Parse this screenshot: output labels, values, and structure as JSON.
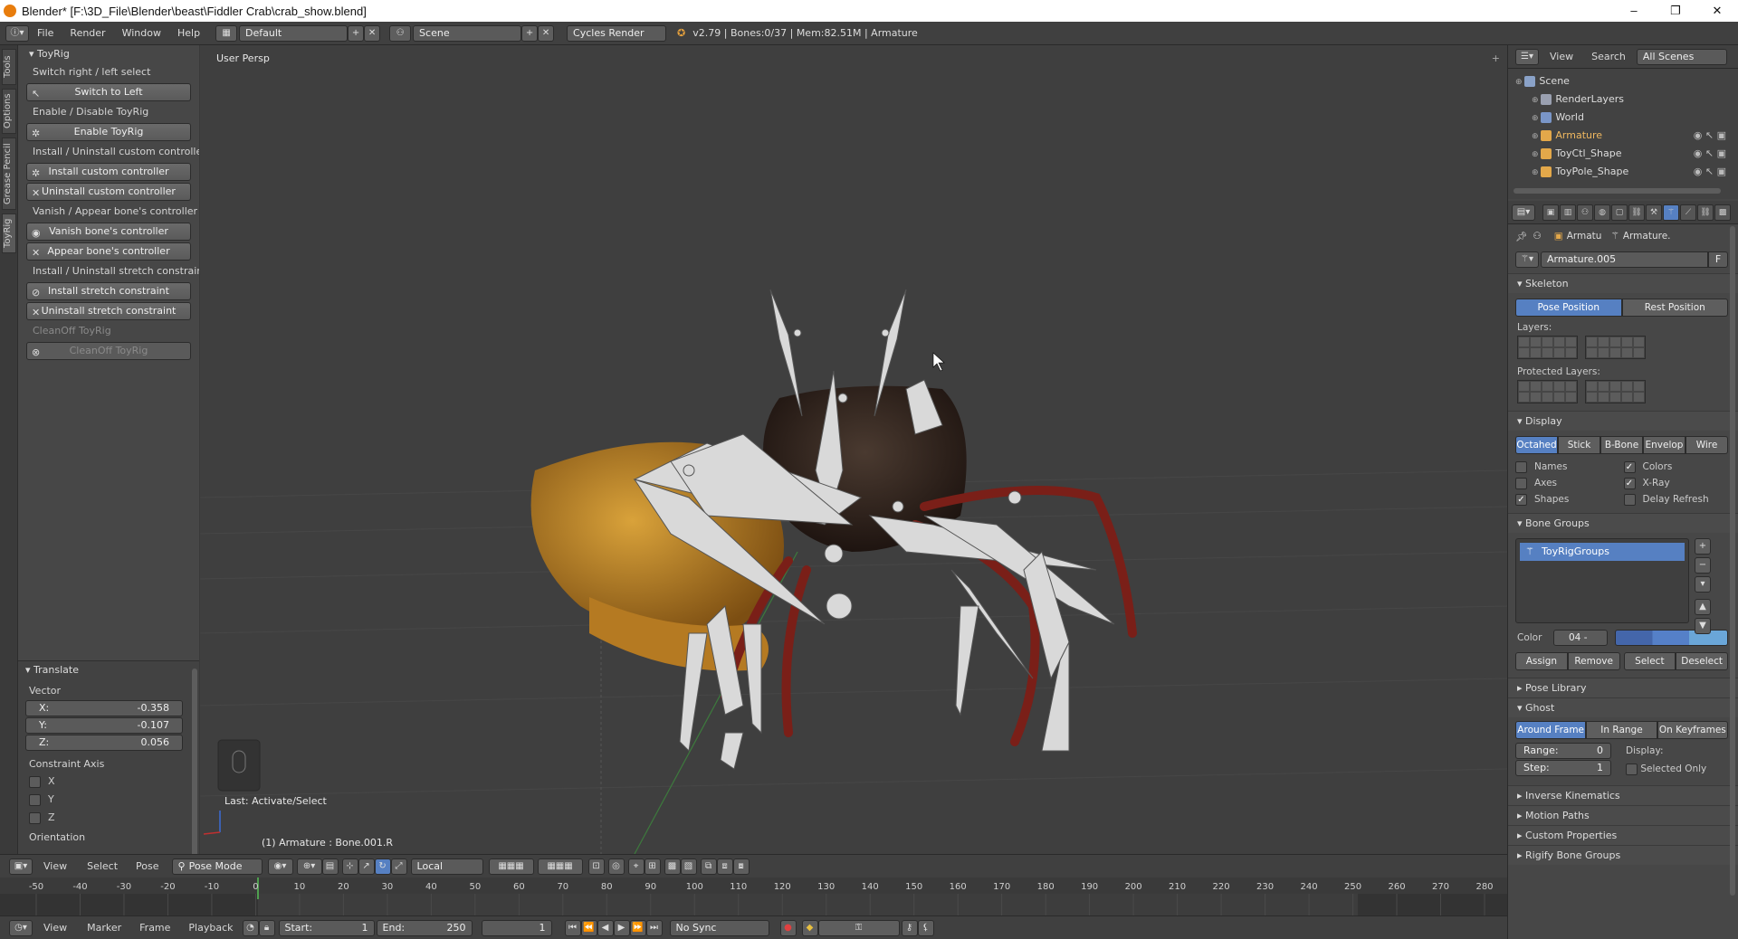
{
  "window": {
    "title": "Blender* [F:\\3D_File\\Blender\\beast\\Fiddler Crab\\crab_show.blend]",
    "controls": [
      "–",
      "❐",
      "✕"
    ]
  },
  "topbar": {
    "menus": [
      "File",
      "Render",
      "Window",
      "Help"
    ],
    "layout": "Default",
    "scene": "Scene",
    "engine": "Cycles Render",
    "stats": "v2.79 | Bones:0/37 | Mem:82.51M | Armature"
  },
  "left_tabs": [
    "Tools",
    "Options",
    "Grease Pencil",
    "ToyRig"
  ],
  "toyrig": {
    "header": "ToyRig",
    "rows": [
      {
        "kind": "label",
        "text": "Switch right / left select"
      },
      {
        "kind": "button",
        "text": "Switch to Left",
        "icon": "↖"
      },
      {
        "kind": "label",
        "text": "Enable / Disable ToyRig"
      },
      {
        "kind": "button",
        "text": "Enable ToyRig",
        "icon": "✲"
      },
      {
        "kind": "label",
        "text": "Install / Uninstall custom controller"
      },
      {
        "kind": "button",
        "text": "Install custom controller",
        "icon": "✲"
      },
      {
        "kind": "button",
        "text": "Uninstall custom controller",
        "icon": "✕"
      },
      {
        "kind": "label",
        "text": "Vanish / Appear bone's controller"
      },
      {
        "kind": "button",
        "text": "Vanish bone's controller",
        "icon": "◉"
      },
      {
        "kind": "button",
        "text": "Appear bone's controller",
        "icon": "✕"
      },
      {
        "kind": "label",
        "text": "Install / Uninstall stretch constraint"
      },
      {
        "kind": "button",
        "text": "Install stretch constraint",
        "icon": "⊘"
      },
      {
        "kind": "button",
        "text": "Uninstall stretch constraint",
        "icon": "✕"
      },
      {
        "kind": "label-dis",
        "text": "CleanOff ToyRig"
      },
      {
        "kind": "button-dis",
        "text": "CleanOff ToyRig",
        "icon": "⊗"
      }
    ]
  },
  "translate": {
    "header": "Translate",
    "vector_label": "Vector",
    "x": {
      "label": "X:",
      "value": "-0.358"
    },
    "y": {
      "label": "Y:",
      "value": "-0.107"
    },
    "z": {
      "label": "Z:",
      "value": "0.056"
    },
    "constraint_label": "Constraint Axis",
    "axes": [
      "X",
      "Y",
      "Z"
    ],
    "orientation_label": "Orientation"
  },
  "viewport": {
    "view_label": "User Persp",
    "last_op": "Last: Activate/Select",
    "active": "(1) Armature : Bone.001.R"
  },
  "viewport_header": {
    "menus": [
      "View",
      "Select",
      "Pose"
    ],
    "mode": "Pose Mode",
    "orientation": "Local"
  },
  "timeline": {
    "ticks": [
      "-50",
      "-40",
      "-30",
      "-20",
      "-10",
      "0",
      "10",
      "20",
      "30",
      "40",
      "50",
      "60",
      "70",
      "80",
      "90",
      "100",
      "110",
      "120",
      "130",
      "140",
      "150",
      "160",
      "170",
      "180",
      "190",
      "200",
      "210",
      "220",
      "230",
      "240",
      "250",
      "260",
      "270",
      "280"
    ],
    "menus": [
      "View",
      "Marker",
      "Frame",
      "Playback"
    ],
    "start_label": "Start:",
    "start": "1",
    "end_label": "End:",
    "end": "250",
    "current": "1",
    "sync": "No Sync"
  },
  "outliner": {
    "menus": [
      "View",
      "Search"
    ],
    "filter": "All Scenes",
    "items": [
      {
        "name": "Scene",
        "indent": 0,
        "color": "#8aa2c8"
      },
      {
        "name": "RenderLayers",
        "indent": 1,
        "color": "#9aa0b0"
      },
      {
        "name": "World",
        "indent": 1,
        "color": "#7a96c8"
      },
      {
        "name": "Armature",
        "indent": 1,
        "color": "#e3a84a",
        "highlight": true
      },
      {
        "name": "ToyCtl_Shape",
        "indent": 1,
        "color": "#e3a84a"
      },
      {
        "name": "ToyPole_Shape",
        "indent": 1,
        "color": "#e3a84a"
      }
    ]
  },
  "properties": {
    "breadcrumb": [
      "Armatu",
      "Armature."
    ],
    "datablock": "Armature.005",
    "datablock_flag": "F",
    "skeleton": {
      "header": "Skeleton",
      "positions": [
        "Pose Position",
        "Rest Position"
      ],
      "layers_label": "Layers:",
      "protected_label": "Protected Layers:"
    },
    "display": {
      "header": "Display",
      "modes": [
        "Octahed",
        "Stick",
        "B-Bone",
        "Envelop",
        "Wire"
      ],
      "checks": [
        {
          "label": "Names",
          "checked": false
        },
        {
          "label": "Colors",
          "checked": true
        },
        {
          "label": "Axes",
          "checked": false
        },
        {
          "label": "X-Ray",
          "checked": true
        },
        {
          "label": "Shapes",
          "checked": true
        },
        {
          "label": "Delay Refresh",
          "checked": false
        }
      ]
    },
    "bone_groups": {
      "header": "Bone Groups",
      "items": [
        "ToyRigGroups"
      ],
      "color_label": "Color",
      "color_value": "04 -",
      "buttons": [
        "Assign",
        "Remove",
        "Select",
        "Deselect"
      ]
    },
    "pose_library": "Pose Library",
    "ghost": {
      "header": "Ghost",
      "modes": [
        "Around Frame",
        "In Range",
        "On Keyframes"
      ],
      "range_label": "Range:",
      "range": "0",
      "step_label": "Step:",
      "step": "1",
      "display_label": "Display:",
      "selected_only": "Selected Only"
    },
    "closed_sections": [
      "Inverse Kinematics",
      "Motion Paths",
      "Custom Properties",
      "Rigify Bone Groups"
    ]
  }
}
